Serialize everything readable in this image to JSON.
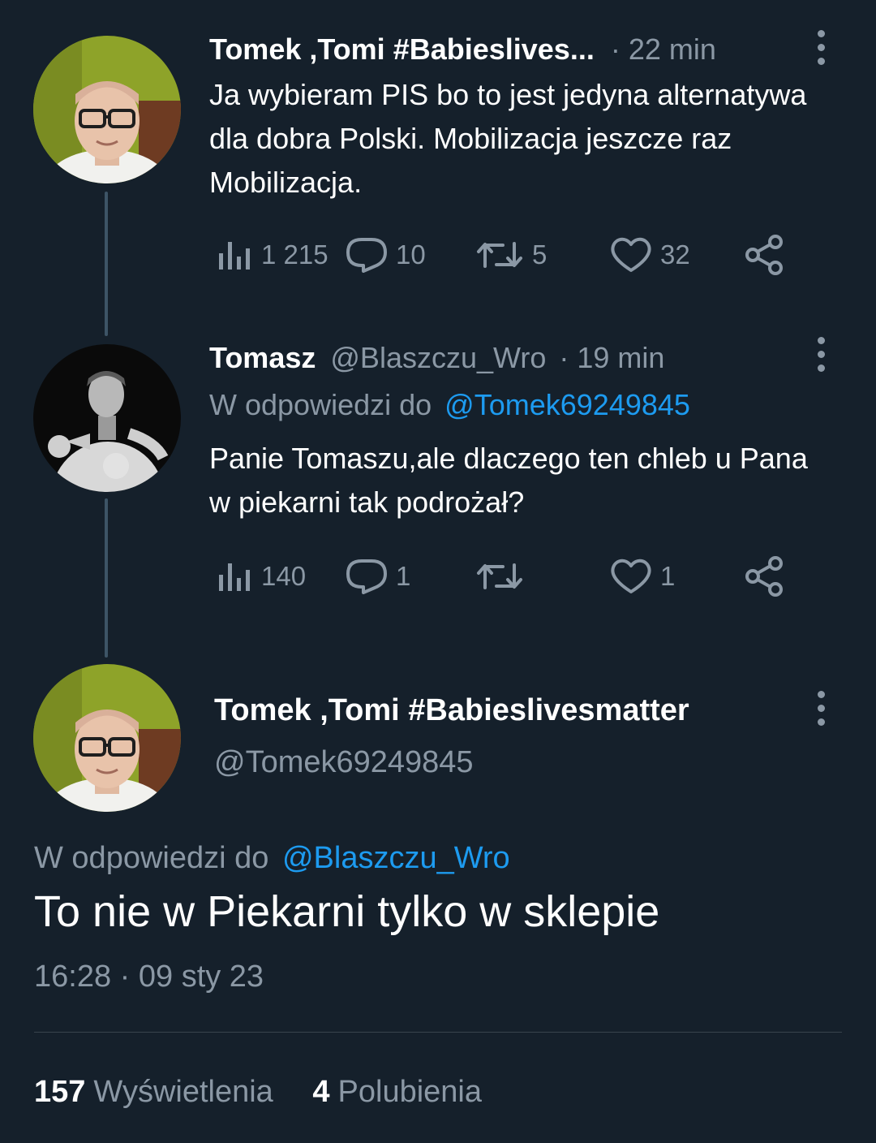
{
  "tweets": [
    {
      "name": "Tomek ,Tomi #Babieslives...",
      "handle": "",
      "time": "· 22 min",
      "text": "Ja wybieram PIS bo to jest jedyna alternatywa dla dobra Polski. Mobilizacja jeszcze raz Mobilizacja.",
      "reply_prefix": "",
      "reply_to": "",
      "views": "1 215",
      "replies": "10",
      "retweets": "5",
      "likes": "32"
    },
    {
      "name": "Tomasz",
      "handle": "@Blaszczu_Wro",
      "time": "· 19 min",
      "text": "Panie Tomaszu,ale dlaczego ten chleb u Pana w piekarni tak podrożał?",
      "reply_prefix": "W odpowiedzi do",
      "reply_to": "@Tomek69249845",
      "views": "140",
      "replies": "1",
      "retweets": "",
      "likes": "1"
    }
  ],
  "main_tweet": {
    "name": "Tomek ,Tomi #Babieslivesmatter",
    "handle": "@Tomek69249845",
    "reply_prefix": "W odpowiedzi do",
    "reply_to": "@Blaszczu_Wro",
    "text": "To nie w Piekarni tylko w sklepie",
    "timestamp": "16:28 · 09 sty 23",
    "views_count": "157",
    "views_label": "Wyświetlenia",
    "likes_count": "4",
    "likes_label": "Polubienia"
  },
  "colors": {
    "background": "#15202b",
    "text": "#ffffff",
    "muted": "#8b98a5",
    "link": "#1d9bf0",
    "thread_line": "#3d5466",
    "divider": "#38444d"
  },
  "icons": [
    "views-icon",
    "reply-icon",
    "retweet-icon",
    "like-icon",
    "share-icon",
    "more-icon"
  ]
}
